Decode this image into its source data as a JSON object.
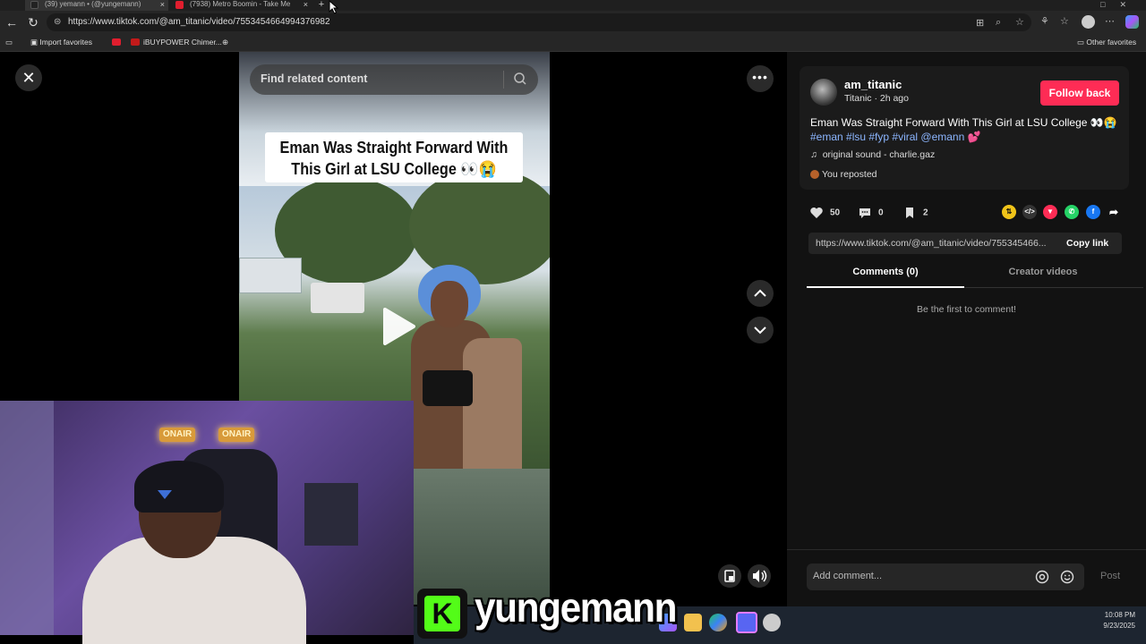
{
  "browser": {
    "tabs": [
      {
        "label": "(39) yemann • (@yungemann)",
        "active": true
      },
      {
        "label": "(7938) Metro Boomin - Take Me",
        "active": false
      }
    ],
    "url": "https://www.tiktok.com/@am_titanic/video/7553454664994376982",
    "bookmarks": {
      "import": "Import favorites",
      "ibuypower": "iBUYPOWER Chimer...",
      "other": "Other favorites"
    }
  },
  "video": {
    "search_placeholder": "Find related content",
    "caption_line1": "Eman Was Straight Forward With",
    "caption_line2": "This Girl at LSU College 👀😭",
    "neon_left": "ONAIR",
    "neon_right": "ONAIR"
  },
  "stream": {
    "name": "yungemann",
    "logo_letter": "K"
  },
  "taskbar": {
    "time": "10:08 PM",
    "date": "9/23/2025"
  },
  "post": {
    "username": "am_titanic",
    "subline": "Titanic · 2h ago",
    "follow_label": "Follow back",
    "description": "Eman Was Straight Forward With This Girl at LSU College 👀😭",
    "hashtags": "#eman #lsu #fyp #viral @emann 💕",
    "sound": "original sound - charlie.gaz",
    "reposted": "You reposted",
    "likes": "50",
    "comments": "0",
    "saves": "2",
    "link": "https://www.tiktok.com/@am_titanic/video/755345466...",
    "copy_label": "Copy link",
    "tab_comments": "Comments (0)",
    "tab_creator": "Creator videos",
    "empty_comments": "Be the first to comment!",
    "comment_placeholder": "Add comment...",
    "post_label": "Post"
  },
  "colors": {
    "accent": "#fe2c55",
    "hashtag": "#8cb6ff",
    "kick_green": "#53fc18"
  }
}
